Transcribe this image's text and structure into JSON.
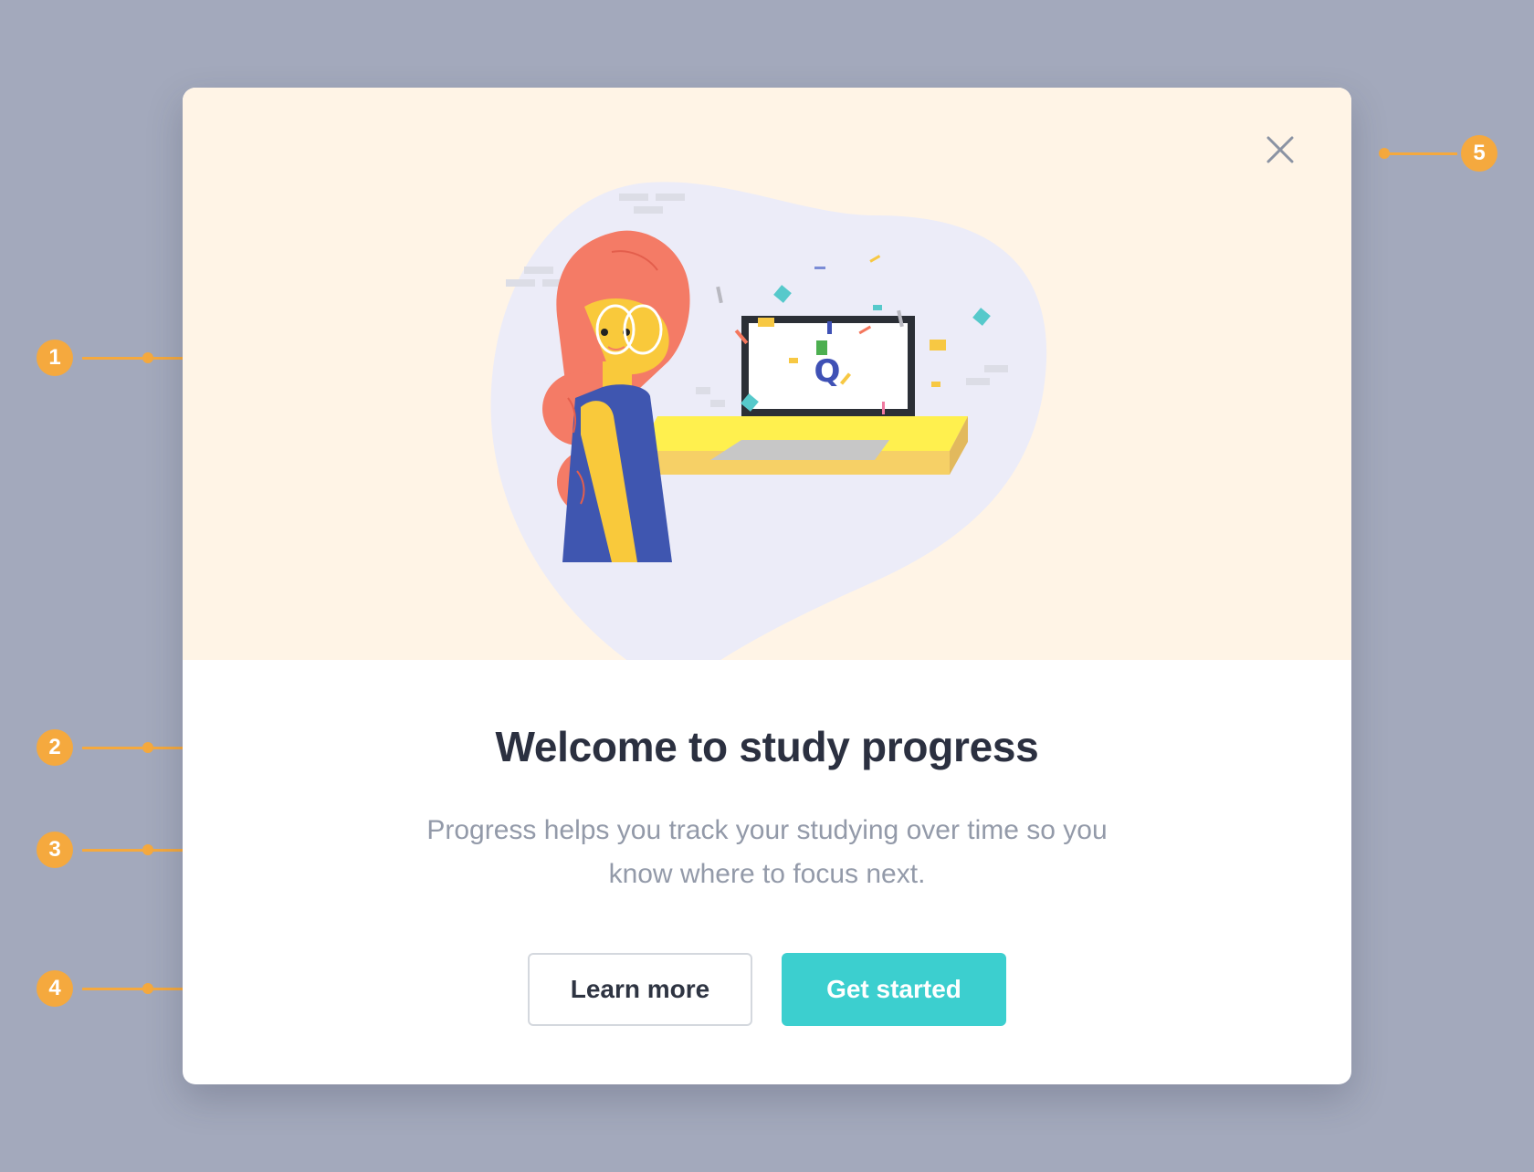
{
  "modal": {
    "title": "Welcome to study progress",
    "description": "Progress helps you track your studying over time so you know where to focus next.",
    "secondary_button_label": "Learn more",
    "primary_button_label": "Get started",
    "close_icon": "close-icon",
    "illustration_letter": "Q"
  },
  "annotations": [
    {
      "number": "1"
    },
    {
      "number": "2"
    },
    {
      "number": "3"
    },
    {
      "number": "4"
    },
    {
      "number": "5"
    }
  ],
  "colors": {
    "backdrop": "#a3a9bc",
    "hero_background": "#fff4e6",
    "primary_button": "#3ccfcf",
    "annotation": "#f5a93e",
    "title": "#2b3040",
    "description": "#939aa9"
  }
}
